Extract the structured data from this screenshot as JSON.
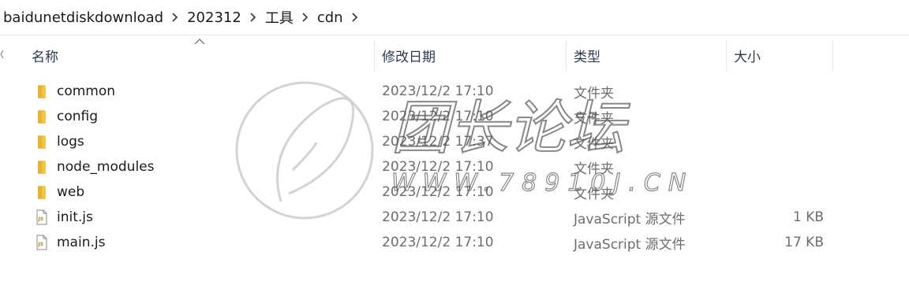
{
  "breadcrumb": [
    "baidunetdiskdownload",
    "202312",
    "工具",
    "cdn"
  ],
  "columns": {
    "name": "名称",
    "modified": "修改日期",
    "type": "类型",
    "size": "大小"
  },
  "files": [
    {
      "name": "common",
      "modified": "2023/12/2 17:10",
      "type": "文件夹",
      "size": "",
      "icon": "folder-icon"
    },
    {
      "name": "config",
      "modified": "2023/12/2 17:10",
      "type": "文件夹",
      "size": "",
      "icon": "folder-icon"
    },
    {
      "name": "logs",
      "modified": "2023/12/2 17:37",
      "type": "文件夹",
      "size": "",
      "icon": "folder-icon"
    },
    {
      "name": "node_modules",
      "modified": "2023/12/2 17:10",
      "type": "文件夹",
      "size": "",
      "icon": "folder-icon"
    },
    {
      "name": "web",
      "modified": "2023/12/2 17:10",
      "type": "文件夹",
      "size": "",
      "icon": "folder-icon"
    },
    {
      "name": "init.js",
      "modified": "2023/12/2 17:10",
      "type": "JavaScript 源文件",
      "size": "1 KB",
      "icon": "js-file-icon"
    },
    {
      "name": "main.js",
      "modified": "2023/12/2 17:10",
      "type": "JavaScript 源文件",
      "size": "17 KB",
      "icon": "js-file-icon"
    }
  ],
  "watermark": {
    "title": "团长论坛",
    "url": "WWW.78910J.CN"
  },
  "colors": {
    "folder": "#f4c542",
    "header_text": "#2b3a55",
    "secondary_text": "#6d6d6d"
  }
}
